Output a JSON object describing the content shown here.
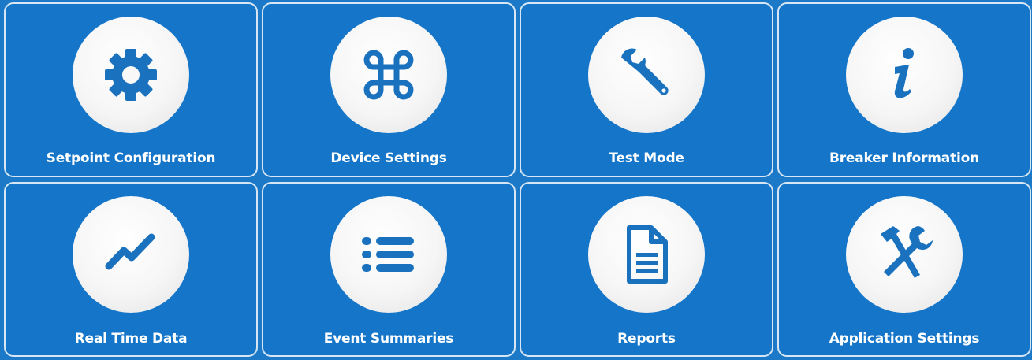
{
  "colors": {
    "tile_background": "#1576c9",
    "tile_border": "#d6e6f4",
    "icon_color": "#1a72bf",
    "label_color": "#ffffff"
  },
  "tiles": [
    {
      "label": "Setpoint Configuration",
      "icon": "gear-icon"
    },
    {
      "label": "Device Settings",
      "icon": "command-icon"
    },
    {
      "label": "Test Mode",
      "icon": "wrench-icon"
    },
    {
      "label": "Breaker Information",
      "icon": "info-icon"
    },
    {
      "label": "Real Time Data",
      "icon": "trend-line-icon"
    },
    {
      "label": "Event Summaries",
      "icon": "list-icon"
    },
    {
      "label": "Reports",
      "icon": "document-icon"
    },
    {
      "label": "Application Settings",
      "icon": "hammer-wrench-icon"
    }
  ]
}
